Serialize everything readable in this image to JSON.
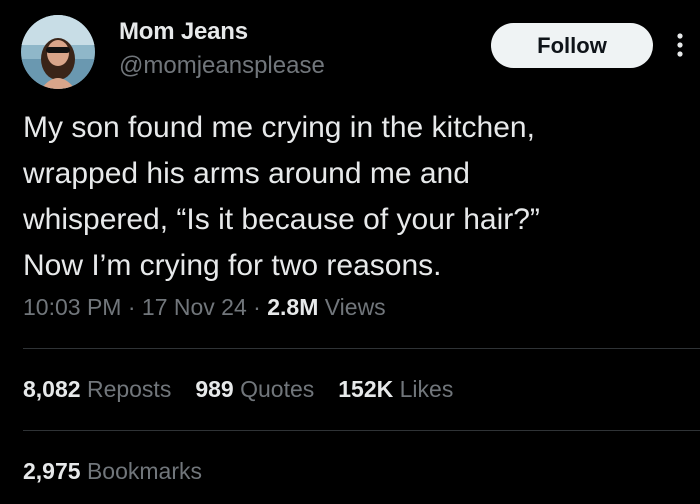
{
  "author": {
    "display_name": "Mom Jeans",
    "handle": "@momjeansplease"
  },
  "actions": {
    "follow_label": "Follow",
    "more_icon": "more-vertical-icon"
  },
  "tweet": {
    "lines": [
      "My son found me crying in the kitchen,",
      "wrapped his arms around me and",
      "whispered, “Is it because of your hair?”",
      "Now I’m crying for two reasons."
    ]
  },
  "meta": {
    "time": "10:03 PM",
    "separator": " · ",
    "date": "17 Nov 24",
    "views_count": "2.8M",
    "views_label": " Views"
  },
  "stats": {
    "reposts_count": "8,082",
    "reposts_label": " Reposts",
    "quotes_count": "989",
    "quotes_label": " Quotes",
    "likes_count": "152K",
    "likes_label": " Likes",
    "bookmarks_count": "2,975",
    "bookmarks_label": " Bookmarks"
  },
  "colors": {
    "background": "#000000",
    "primary_text": "#e7e9ea",
    "secondary_text": "#71767b",
    "divider": "#2f3336",
    "follow_bg": "#eff3f4"
  }
}
